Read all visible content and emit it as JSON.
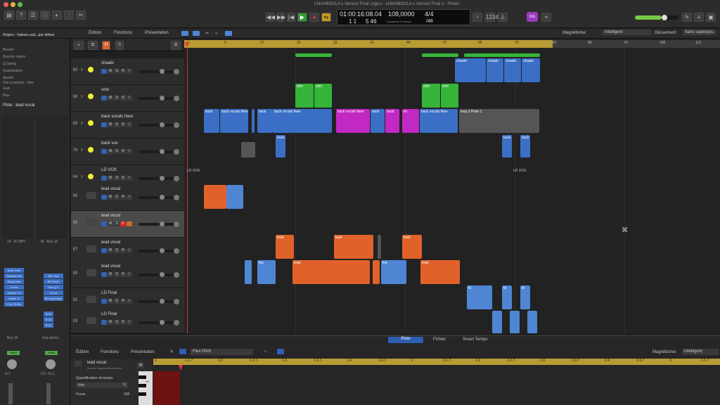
{
  "window_title": "LMAHBOULA x Version Final .logicx - LMAHBOULA x Version Final 2 - Pistes",
  "lcd": {
    "time": "01:00:16:08.04",
    "bpm": "108,0000",
    "signature": "4/4",
    "bars": "1   1",
    "beats": "5  46",
    "tempo_mode": "Conserver le tempo",
    "division": "/48"
  },
  "avatar": "ISG",
  "menubar": {
    "edit": "Édition",
    "functions": "Fonctions",
    "view": "Présentation",
    "snap_label": "Magnétisme:",
    "snap_value": "Intelligent",
    "drag_label": "Glissement:",
    "drag_value": "Sans superpos."
  },
  "inspector": {
    "region_label": "Région : Valeurs aud...par défaut",
    "rows": [
      "Bouclé",
      "Boucler région",
      "Q-Swing",
      "Quantisation",
      "Ajuster",
      "Hist et pointer : Non",
      "Gain"
    ],
    "more": "Plus",
    "track_label": "Piste : lead vocal",
    "plugins_left": [
      "Auto-Tune",
      "Deesser vst",
      "SSL6Chan",
      "CA Int",
      "InVoice 7a",
      "InVibe 14",
      "CLA-76 Mn"
    ],
    "plugins_right": [
      "RIO Vox",
      "RIO RnFi",
      "Pro-Q 3",
      "CA Int",
      "RCompressor"
    ],
    "sends": [
      "B 15",
      "B 16",
      "B 11"
    ],
    "bus_left": "Bus 14",
    "bus_right": "Out stéréo",
    "read_left": "Read",
    "read_right": "Read",
    "val_left": "-4,7",
    "val_right": "0,0   -14,1",
    "io_left": "14 - 8 CBPI",
    "io_right": "M · Bus 14"
  },
  "tracks": [
    {
      "num": "80",
      "name": "chaabi"
    },
    {
      "num": "68",
      "name": "solo"
    },
    {
      "num": "69",
      "name": "back vocals New"
    },
    {
      "num": "76",
      "name": "back vox"
    },
    {
      "num": "84",
      "name": "LD VOX"
    },
    {
      "num": "85",
      "name": "lead vocal"
    },
    {
      "num": "86",
      "name": "lead vocal"
    },
    {
      "num": "87",
      "name": "lead vocal"
    },
    {
      "num": "89",
      "name": "lead vocal"
    },
    {
      "num": "92",
      "name": "LD Final"
    },
    {
      "num": "93",
      "name": "LD Final"
    }
  ],
  "track_buttons": {
    "m": "M",
    "s": "S",
    "r": "R",
    "i": "I"
  },
  "header_buttons": {
    "add": "+",
    "h": "H",
    "s": "S"
  },
  "ruler": [
    "1",
    "9",
    "17",
    "25",
    "33",
    "41",
    "49",
    "57",
    "65",
    "73",
    "81",
    "89",
    "97",
    "105",
    "113"
  ],
  "regions": {
    "chaabi": "chaabi",
    "solo": "solo",
    "bv": "back vocals New",
    "bv_short": "back",
    "bv_b": "bv",
    "loop": "loop 2 Piste 1",
    "backvox": "back",
    "ldvox": "LD VOX",
    "lead": "lead",
    "ld": "ld",
    "lv": "lea"
  },
  "editor": {
    "tabs": [
      "Piste",
      "Fichier",
      "Smart Tempo"
    ],
    "menu": [
      "Édition",
      "Fonctions",
      "Présentation"
    ],
    "mode": "Flex Pitch",
    "snap_label": "Magnétisme:",
    "snap_value": "Intelligent",
    "region_name": "lead vocal",
    "region_sub": "Aucune région sélectionnée",
    "quant_label": "Quantification du temps",
    "quant_value": "Non",
    "q": "Q",
    "focus_label": "Focus",
    "focus_value": "100",
    "ruler": [
      "1",
      "1.1.7",
      "1.2",
      "1.2.7",
      "1.3",
      "1.3.7",
      "1.4",
      "1.4.7",
      "2",
      "2.1.7",
      "2.2",
      "2.2.7",
      "2.3",
      "2.3.7",
      "2.4",
      "2.4.7",
      "3",
      "3.1.7"
    ],
    "c4": "C4"
  }
}
